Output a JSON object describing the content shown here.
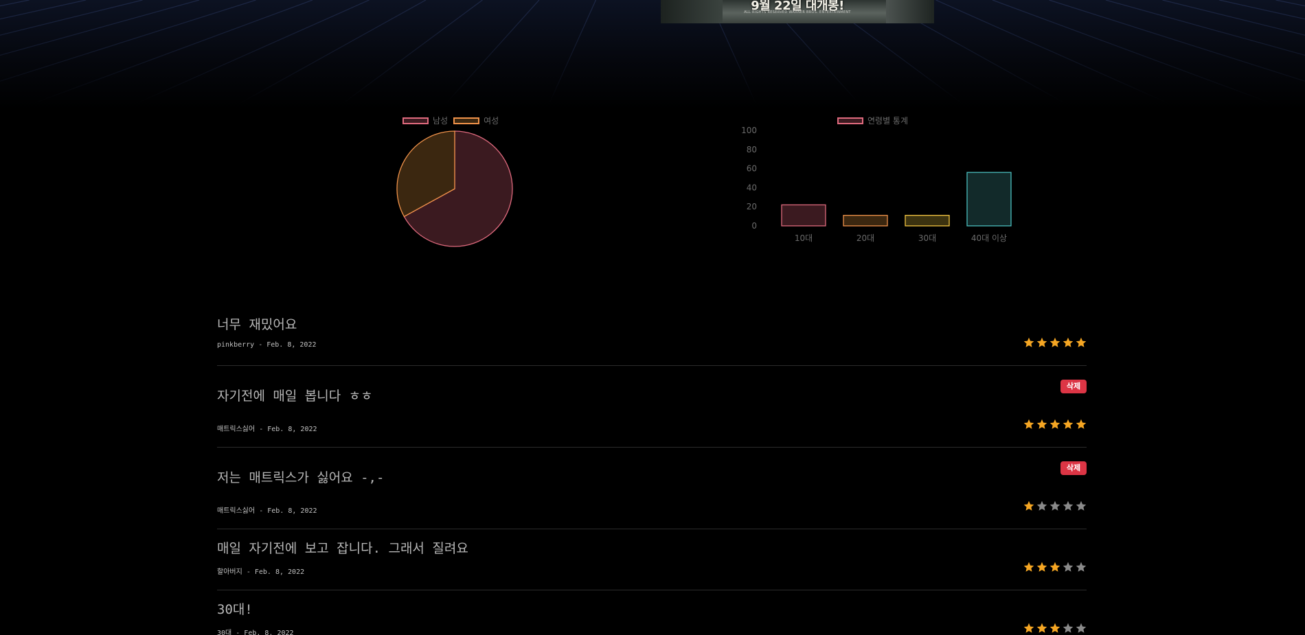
{
  "poster": {
    "headline": "9월 22일 대개봉!",
    "fine_print": "ALL RIGHTS RESERVED  WARNER BROS. ENTERTAINMENT"
  },
  "gender_chart_legend": [
    {
      "label": "남성",
      "color": "#e06a7e"
    },
    {
      "label": "여성",
      "color": "#f0924a"
    }
  ],
  "age_chart_legend": [
    {
      "label": "연령별 통계",
      "color": "#e06a7e"
    }
  ],
  "chart_data": [
    {
      "type": "pie",
      "categories": [
        "남성",
        "여성"
      ],
      "values": [
        67,
        33
      ],
      "colors": {
        "남성": {
          "fill": "#3b1a20",
          "stroke": "#e06a7e"
        },
        "여성": {
          "fill": "#3b2710",
          "stroke": "#f0924a"
        }
      },
      "legend_position": "top"
    },
    {
      "type": "bar",
      "categories": [
        "10대",
        "20대",
        "30대",
        "40대 이상"
      ],
      "series": [
        {
          "name": "연령별 통계",
          "values": [
            22,
            11,
            11,
            56
          ]
        }
      ],
      "colors": [
        {
          "fill": "#3b1a20",
          "stroke": "#e06a7e"
        },
        {
          "fill": "#3b2710",
          "stroke": "#f0924a"
        },
        {
          "fill": "#3b3210",
          "stroke": "#f4c542"
        },
        {
          "fill": "#122a2a",
          "stroke": "#4bbfbf"
        }
      ],
      "ylim": [
        0,
        100
      ],
      "yticks": [
        "100",
        "80",
        "60",
        "40",
        "20",
        "0"
      ],
      "grid": false,
      "legend_position": "top"
    }
  ],
  "reviews": [
    {
      "title": "너무 재밌어요",
      "author": "pinkberry",
      "date": "Feb. 8, 2022",
      "meta": "pinkberry - Feb. 8, 2022",
      "rating": 5,
      "has_delete": false
    },
    {
      "title": "자기전에 매일 봅니다 ㅎㅎ",
      "author": "매트릭스싫어",
      "date": "Feb. 8, 2022",
      "meta": "매트릭스싫어 - Feb. 8, 2022",
      "rating": 5,
      "has_delete": true
    },
    {
      "title": "저는 매트릭스가 싫어요 -,-",
      "author": "매트릭스싫어",
      "date": "Feb. 8, 2022",
      "meta": "매트릭스싫어 - Feb. 8, 2022",
      "rating": 1,
      "has_delete": true
    },
    {
      "title": "매일 자기전에 보고 잡니다. 그래서 질려요",
      "author": "할아버지",
      "date": "Feb. 8, 2022",
      "meta": "할아버지 - Feb. 8, 2022",
      "rating": 3,
      "has_delete": false
    },
    {
      "title": "30대!",
      "author": "30대",
      "date": "Feb. 8, 2022",
      "meta": "30대 - Feb. 8, 2022",
      "rating": 3,
      "has_delete": false
    }
  ],
  "delete_label": "삭제",
  "colors": {
    "star_on": "#f5a623",
    "star_off": "#8a8a8a",
    "delete_bg": "#dc3545"
  }
}
